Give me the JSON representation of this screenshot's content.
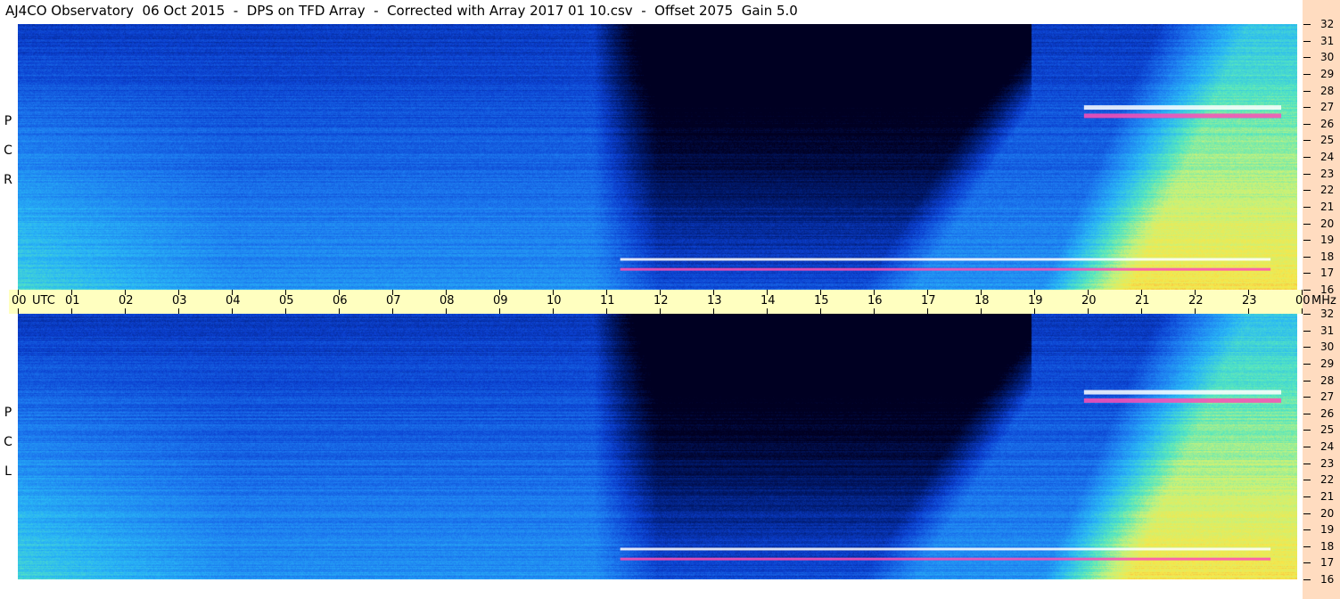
{
  "title": "AJ4CO Observatory  06 Oct 2015  -  DPS on TFD Array  -  Corrected with Array 2017 01 10.csv  -  Offset 2075  Gain 5.0",
  "chart_data": {
    "type": "heatmap",
    "xlabel": "UTC",
    "ylabel": "MHz",
    "x_ticks": [
      "00",
      "01",
      "02",
      "03",
      "04",
      "05",
      "06",
      "07",
      "08",
      "09",
      "10",
      "11",
      "12",
      "13",
      "14",
      "15",
      "16",
      "17",
      "18",
      "19",
      "20",
      "21",
      "22",
      "23",
      "00"
    ],
    "y_ticks": [
      32,
      31,
      30,
      29,
      28,
      27,
      26,
      25,
      24,
      23,
      22,
      21,
      20,
      19,
      18,
      17,
      16
    ],
    "xlim": [
      0,
      24
    ],
    "ylim": [
      16,
      32
    ],
    "panels": [
      {
        "name": "RCP",
        "polarization_label": [
          "R",
          "C",
          "P"
        ],
        "dark_region_utc": [
          11.8,
          19.0
        ],
        "bright_region_utc": [
          20.0,
          24.0
        ],
        "interference_bands_mhz": [
          27,
          26.5,
          17.8,
          17.2
        ]
      },
      {
        "name": "LCP",
        "polarization_label": [
          "L",
          "C",
          "P"
        ],
        "dark_region_utc": [
          11.8,
          19.0
        ],
        "bright_region_utc": [
          20.0,
          24.0
        ],
        "interference_bands_mhz": [
          27.3,
          26.8,
          17.8,
          17.2
        ]
      }
    ],
    "colormap": [
      "#000022",
      "#001a6e",
      "#0b3fcf",
      "#1d7bf0",
      "#29b6f6",
      "#54e6c0",
      "#c8f27a",
      "#f7e74a",
      "#f39c3c",
      "#ff2f9b",
      "#ffffff"
    ],
    "grid": false,
    "legend": "none"
  }
}
